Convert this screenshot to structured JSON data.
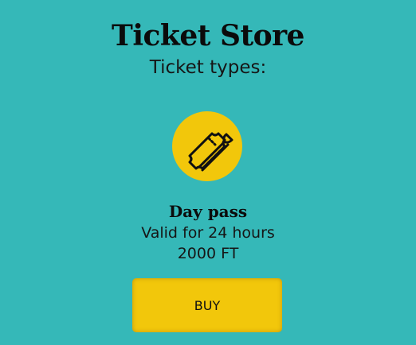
{
  "header": {
    "title": "Ticket Store",
    "subtitle": "Ticket types:"
  },
  "ticket": {
    "icon": "ticket-icon",
    "name": "Day pass",
    "description": "Valid for 24 hours",
    "price": "2000 FT",
    "buy_label": "BUY"
  },
  "colors": {
    "background": "#35b8b8",
    "accent": "#f2c70b",
    "text": "#111111"
  }
}
